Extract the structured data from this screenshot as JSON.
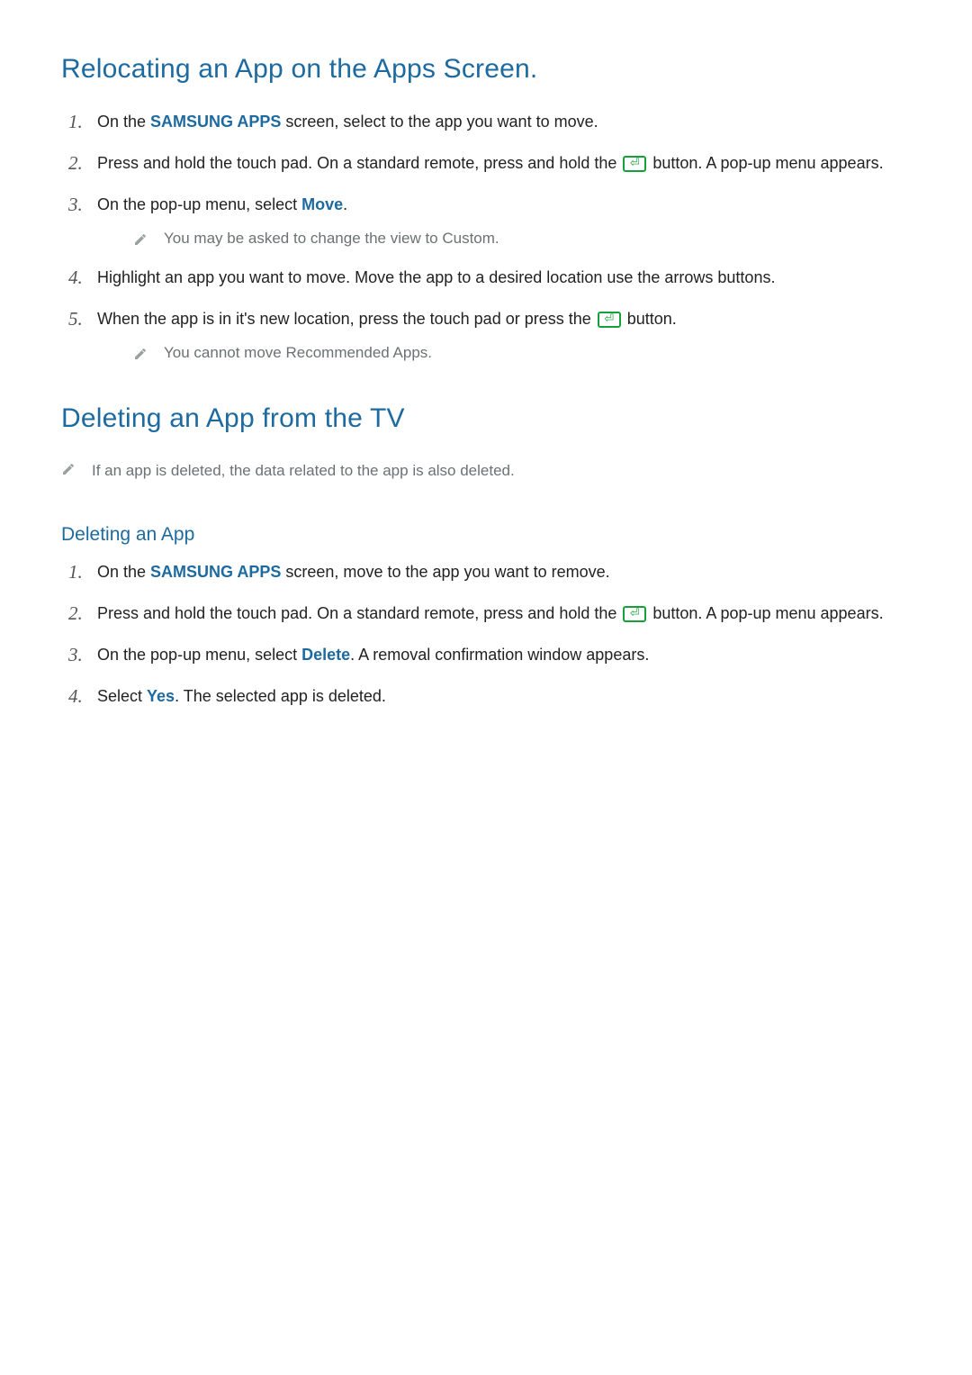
{
  "section1": {
    "title": "Relocating an App on the Apps Screen.",
    "steps": [
      {
        "num": "1.",
        "segments": [
          {
            "t": "text",
            "v": "On the "
          },
          {
            "t": "hl",
            "v": "SAMSUNG APPS"
          },
          {
            "t": "text",
            "v": " screen, select to the app you want to move."
          }
        ]
      },
      {
        "num": "2.",
        "segments": [
          {
            "t": "text",
            "v": "Press and hold the touch pad. On a standard remote, press and hold the "
          },
          {
            "t": "btn"
          },
          {
            "t": "text",
            "v": " button. A pop-up menu appears."
          }
        ]
      },
      {
        "num": "3.",
        "segments": [
          {
            "t": "text",
            "v": "On the pop-up menu, select "
          },
          {
            "t": "hl",
            "v": "Move"
          },
          {
            "t": "text",
            "v": "."
          }
        ],
        "note": "You may be asked to change the view to Custom."
      },
      {
        "num": "4.",
        "segments": [
          {
            "t": "text",
            "v": "Highlight an app you want to move. Move the app to a desired location use the arrows buttons."
          }
        ]
      },
      {
        "num": "5.",
        "segments": [
          {
            "t": "text",
            "v": "When the app is in it's new location, press the touch pad or press the "
          },
          {
            "t": "btn"
          },
          {
            "t": "text",
            "v": " button."
          }
        ],
        "note": "You cannot move Recommended Apps."
      }
    ]
  },
  "section2": {
    "title": "Deleting an App from the TV",
    "note": "If an app is deleted, the data related to the app is also deleted.",
    "sub_title": "Deleting an App",
    "steps": [
      {
        "num": "1.",
        "segments": [
          {
            "t": "text",
            "v": "On the "
          },
          {
            "t": "hl",
            "v": "SAMSUNG APPS"
          },
          {
            "t": "text",
            "v": " screen, move to the app you want to remove."
          }
        ]
      },
      {
        "num": "2.",
        "segments": [
          {
            "t": "text",
            "v": "Press and hold the touch pad. On a standard remote, press and hold the "
          },
          {
            "t": "btn"
          },
          {
            "t": "text",
            "v": " button. A pop-up menu appears."
          }
        ]
      },
      {
        "num": "3.",
        "segments": [
          {
            "t": "text",
            "v": "On the pop-up menu, select "
          },
          {
            "t": "hl",
            "v": "Delete"
          },
          {
            "t": "text",
            "v": ". A removal confirmation window appears."
          }
        ]
      },
      {
        "num": "4.",
        "segments": [
          {
            "t": "text",
            "v": "Select "
          },
          {
            "t": "hl",
            "v": "Yes"
          },
          {
            "t": "text",
            "v": ". The selected app is deleted."
          }
        ]
      }
    ]
  }
}
